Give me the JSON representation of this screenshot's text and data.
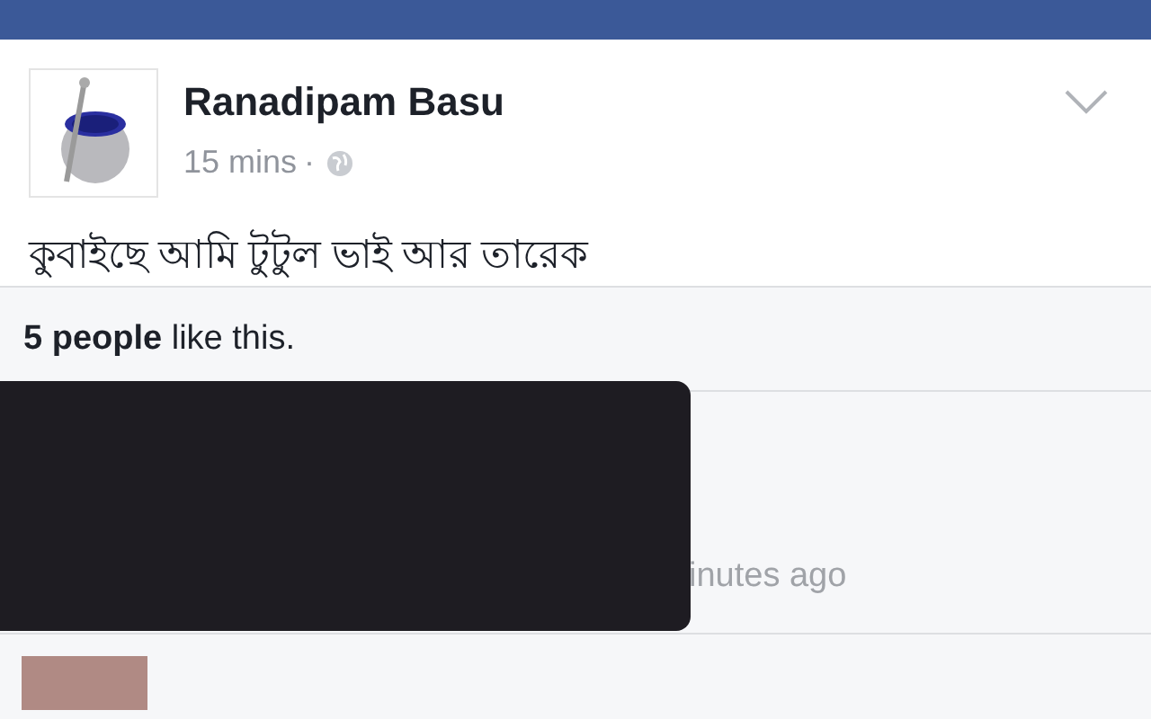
{
  "post": {
    "author": "Ranadipam Basu",
    "time": "15 mins",
    "separator": "·",
    "text": "কুবাইছে আমি টুটুল ভাই আর তারেক"
  },
  "likes": {
    "text": "**5 people** like this."
  },
  "comments": [
    {
      "time": "inutes ago",
      "redacted": true
    }
  ]
}
